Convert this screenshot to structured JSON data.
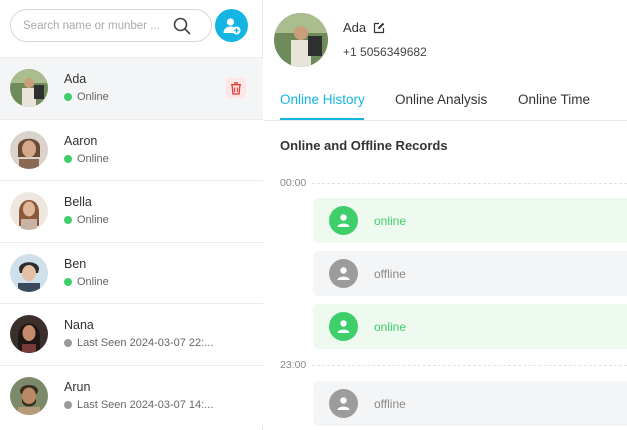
{
  "search": {
    "placeholder": "Search name or munber ..."
  },
  "contacts": [
    {
      "name": "Ada",
      "status": "Online",
      "online": true
    },
    {
      "name": "Aaron",
      "status": "Online",
      "online": true
    },
    {
      "name": "Bella",
      "status": "Online",
      "online": true
    },
    {
      "name": "Ben",
      "status": "Online",
      "online": true
    },
    {
      "name": "Nana",
      "status": "Last Seen 2024-03-07 22:...",
      "online": false
    },
    {
      "name": "Arun",
      "status": "Last Seen 2024-03-07 14:...",
      "online": false
    }
  ],
  "profile": {
    "name": "Ada",
    "phone": "+1 5056349682"
  },
  "tabs": [
    {
      "label": "Online History"
    },
    {
      "label": "Online Analysis"
    },
    {
      "label": "Online Time"
    }
  ],
  "section_title": "Online and Offline Records",
  "timeline": {
    "time_labels": [
      "00:00",
      "23:00"
    ],
    "records": [
      {
        "label": "online",
        "state": "on"
      },
      {
        "label": "offline",
        "state": "off"
      },
      {
        "label": "online",
        "state": "on"
      },
      {
        "label": "offline",
        "state": "off"
      }
    ]
  },
  "colors": {
    "accent": "#14b4e3",
    "online": "#3ecf6a",
    "offline": "#9c9c9c",
    "delete": "#e53935"
  }
}
